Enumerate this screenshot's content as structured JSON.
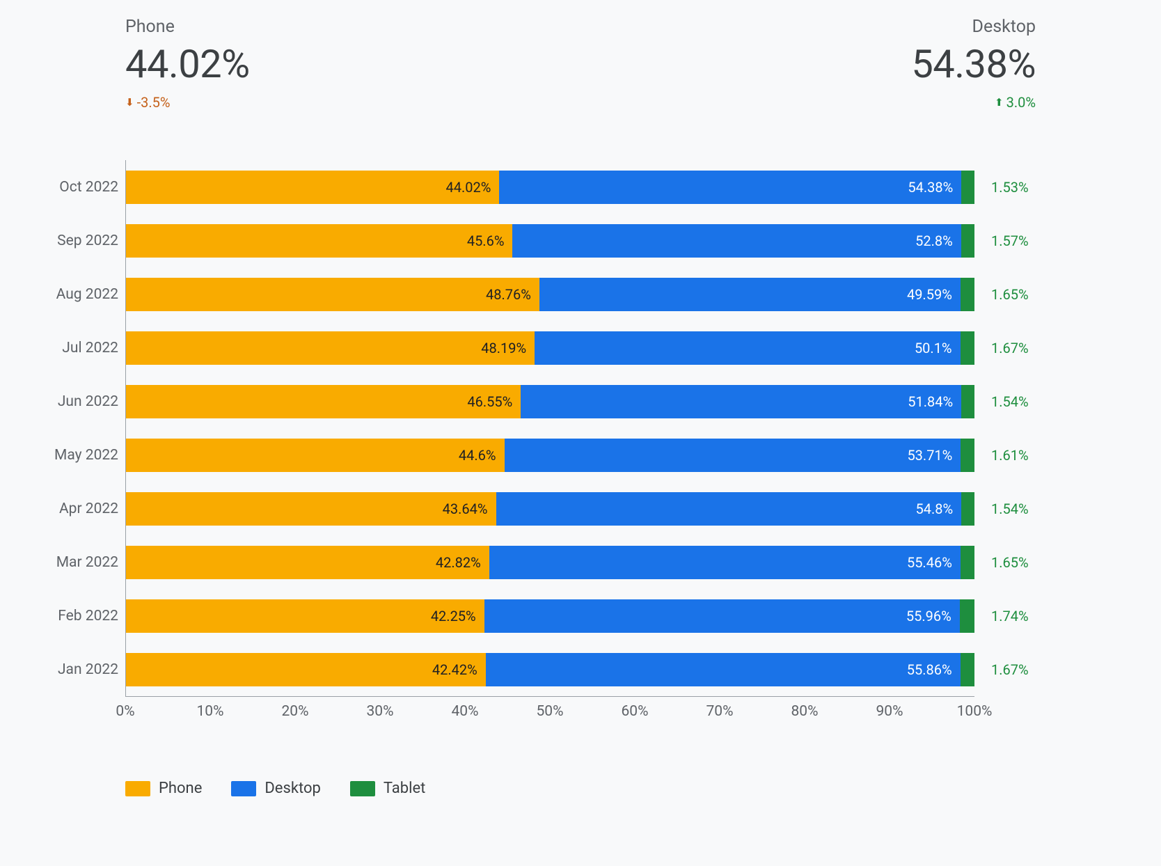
{
  "kpi_left": {
    "label": "Phone",
    "value": "44.02%",
    "delta": "-3.5%",
    "dir": "down"
  },
  "kpi_right": {
    "label": "Desktop",
    "value": "54.38%",
    "delta": "3.0%",
    "dir": "up"
  },
  "legend": {
    "phone": "Phone",
    "desktop": "Desktop",
    "tablet": "Tablet"
  },
  "xticks": [
    "0%",
    "10%",
    "20%",
    "30%",
    "40%",
    "50%",
    "60%",
    "70%",
    "80%",
    "90%",
    "100%"
  ],
  "chart_data": {
    "type": "bar",
    "orientation": "horizontal-stacked-100",
    "xlabel": "",
    "ylabel": "",
    "xlim": [
      0,
      100
    ],
    "legend_position": "bottom",
    "categories": [
      "Oct 2022",
      "Sep 2022",
      "Aug 2022",
      "Jul 2022",
      "Jun 2022",
      "May 2022",
      "Apr 2022",
      "Mar 2022",
      "Feb 2022",
      "Jan 2022"
    ],
    "series": [
      {
        "name": "Phone",
        "color": "#f9ab00",
        "values": [
          44.02,
          45.6,
          48.76,
          48.19,
          46.55,
          44.6,
          43.64,
          42.82,
          42.25,
          42.42
        ]
      },
      {
        "name": "Desktop",
        "color": "#1a73e8",
        "values": [
          54.38,
          52.8,
          49.59,
          50.1,
          51.84,
          53.71,
          54.8,
          55.46,
          55.96,
          55.86
        ]
      },
      {
        "name": "Tablet",
        "color": "#1e8e3e",
        "values": [
          1.53,
          1.57,
          1.65,
          1.67,
          1.54,
          1.61,
          1.54,
          1.65,
          1.74,
          1.67
        ]
      }
    ],
    "value_labels": {
      "Phone": [
        "44.02%",
        "45.6%",
        "48.76%",
        "48.19%",
        "46.55%",
        "44.6%",
        "43.64%",
        "42.82%",
        "42.25%",
        "42.42%"
      ],
      "Desktop": [
        "54.38%",
        "52.8%",
        "49.59%",
        "50.1%",
        "51.84%",
        "53.71%",
        "54.8%",
        "55.46%",
        "55.96%",
        "55.86%"
      ],
      "Tablet": [
        "1.53%",
        "1.57%",
        "1.65%",
        "1.67%",
        "1.54%",
        "1.61%",
        "1.54%",
        "1.65%",
        "1.74%",
        "1.67%"
      ]
    }
  }
}
